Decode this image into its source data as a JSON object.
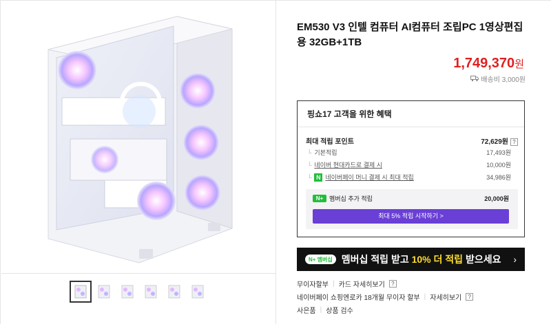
{
  "product": {
    "title": "EM530 V3 인텔 컴퓨터 AI컴퓨터 조립PC 1영상편집용 32GB+1TB",
    "price": "1,749,370",
    "price_unit": "원",
    "shipping": "배송비 3,000원"
  },
  "benefits": {
    "header": "핑쇼17 고객을 위한 혜택",
    "max_points_label": "최대 적립 포인트",
    "max_points_value": "72,629원",
    "rows": [
      {
        "label": "기본적립",
        "value": "17,493원"
      },
      {
        "label": "네이버 현대카드로 결제 시",
        "value": "10,000원"
      },
      {
        "label": "네이버페이 머니 결제 시 최대 적립",
        "value": "34,986원"
      }
    ],
    "membership_label": "멤버십 추가 적립",
    "membership_value": "20,000원",
    "membership_button": "최대 5% 적립 시작하기 >"
  },
  "banner": {
    "badge": "N+ 멤버십",
    "text_before": "멤버십 적립 받고 ",
    "highlight": "10% 더 적립",
    "text_after": " 받으세요",
    "chevron": "›"
  },
  "info": {
    "line1_a": "무이자할부",
    "line1_b": "카드 자세히보기",
    "line2_a": "네이버페이 쇼핑엔로카 18개월 무이자 할부",
    "line2_b": "자세히보기",
    "line3_a": "사은품",
    "line3_b": "상품 검수"
  },
  "icons": {
    "truck": "truck-icon",
    "question": "?",
    "npay": "N"
  },
  "colors": {
    "price": "#e02020",
    "membership_button": "#6a3fd6",
    "naver_green": "#1fbf3a",
    "banner_bg": "#111111",
    "highlight": "#ffde2e"
  }
}
